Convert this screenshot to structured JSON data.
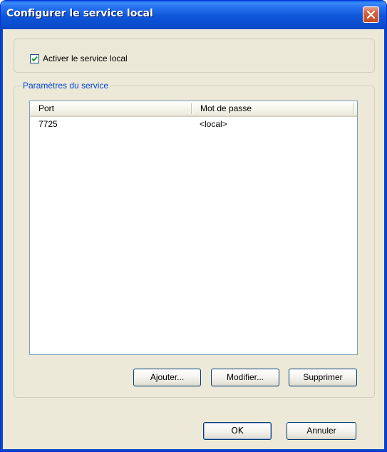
{
  "window": {
    "title": "Configurer le service local",
    "close_icon": "close-icon"
  },
  "enable_service": {
    "label": "Activer le service local",
    "checked": true
  },
  "service_settings": {
    "group_title": "Paramètres du service",
    "columns": [
      "Port",
      "Mot de passe"
    ],
    "rows": [
      {
        "port": "7725",
        "password": "<local>"
      }
    ]
  },
  "list_actions": {
    "add_label": "Ajouter...",
    "edit_label": "Modifier...",
    "delete_label": "Supprimer"
  },
  "dialog_actions": {
    "ok_label": "OK",
    "cancel_label": "Annuler"
  },
  "colors": {
    "titlebar": "#0a5fe8",
    "dialog_background": "#ece9d8",
    "group_title": "#0046d5",
    "close_button": "#d8613f"
  }
}
